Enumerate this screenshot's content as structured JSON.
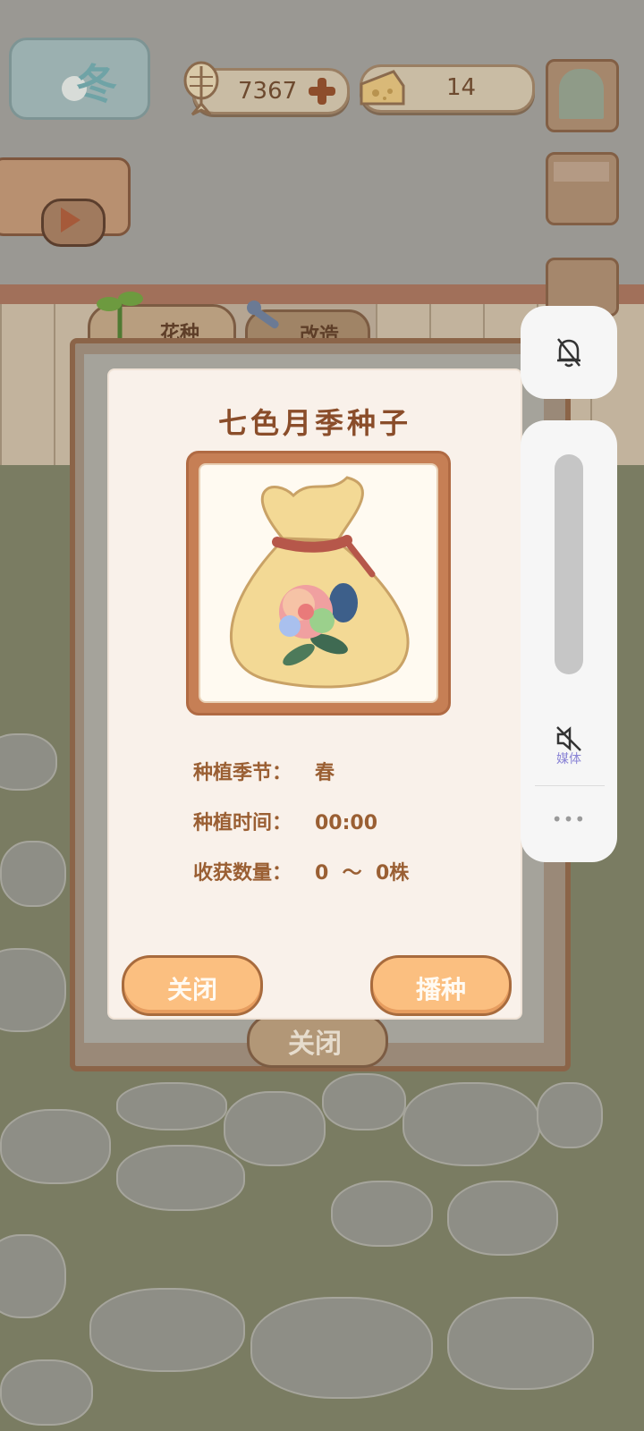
{
  "hud": {
    "season": "冬",
    "fish_count": "7367",
    "cheese_count": "14"
  },
  "tabs": [
    {
      "label": "花种",
      "active": true
    },
    {
      "label": "改造",
      "active": false
    }
  ],
  "back_panel": {
    "close_label": "关闭"
  },
  "dialog": {
    "title": "七色月季种子",
    "item_image": "rainbow-rose-seed-bag",
    "info": [
      {
        "label": "种植季节：",
        "value": "春"
      },
      {
        "label": "种植时间：",
        "value": "00:00"
      },
      {
        "label": "收获数量：",
        "value": "0  ～  0株"
      }
    ],
    "close_button": "关闭",
    "sow_button": "播种"
  },
  "volume_overlay": {
    "media_label": "媒体",
    "more": "•••",
    "ringer_muted": true,
    "media_muted": true,
    "media_level": 0
  },
  "colors": {
    "paper": "#f9f1ea",
    "title_brown": "#8a4d2a",
    "button_orange": "#fbbf80",
    "frame_brown": "#c67f55",
    "overlay_bg": "#f6f6f6",
    "media_label": "#8b85d6"
  }
}
